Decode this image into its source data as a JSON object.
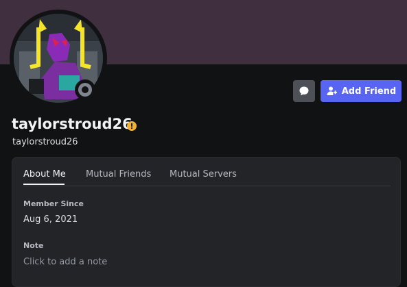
{
  "profile": {
    "display_name": "taylorstroud26",
    "username": "taylorstroud26",
    "avatar_icon": "robot-avatar-icon",
    "status": "offline",
    "badge_icon": "warning-icon"
  },
  "actions": {
    "message_icon": "chat-bubble-icon",
    "add_friend_label": "Add Friend"
  },
  "tabs": [
    {
      "label": "About Me",
      "active": true
    },
    {
      "label": "Mutual Friends",
      "active": false
    },
    {
      "label": "Mutual Servers",
      "active": false
    }
  ],
  "about": {
    "member_since_label": "Member Since",
    "member_since_value": "Aug 6, 2021",
    "note_label": "Note",
    "note_placeholder": "Click to add a note"
  },
  "colors": {
    "banner": "#3f2f3f",
    "background": "#111214",
    "brand": "#5865f2",
    "warning": "#f0b232"
  }
}
